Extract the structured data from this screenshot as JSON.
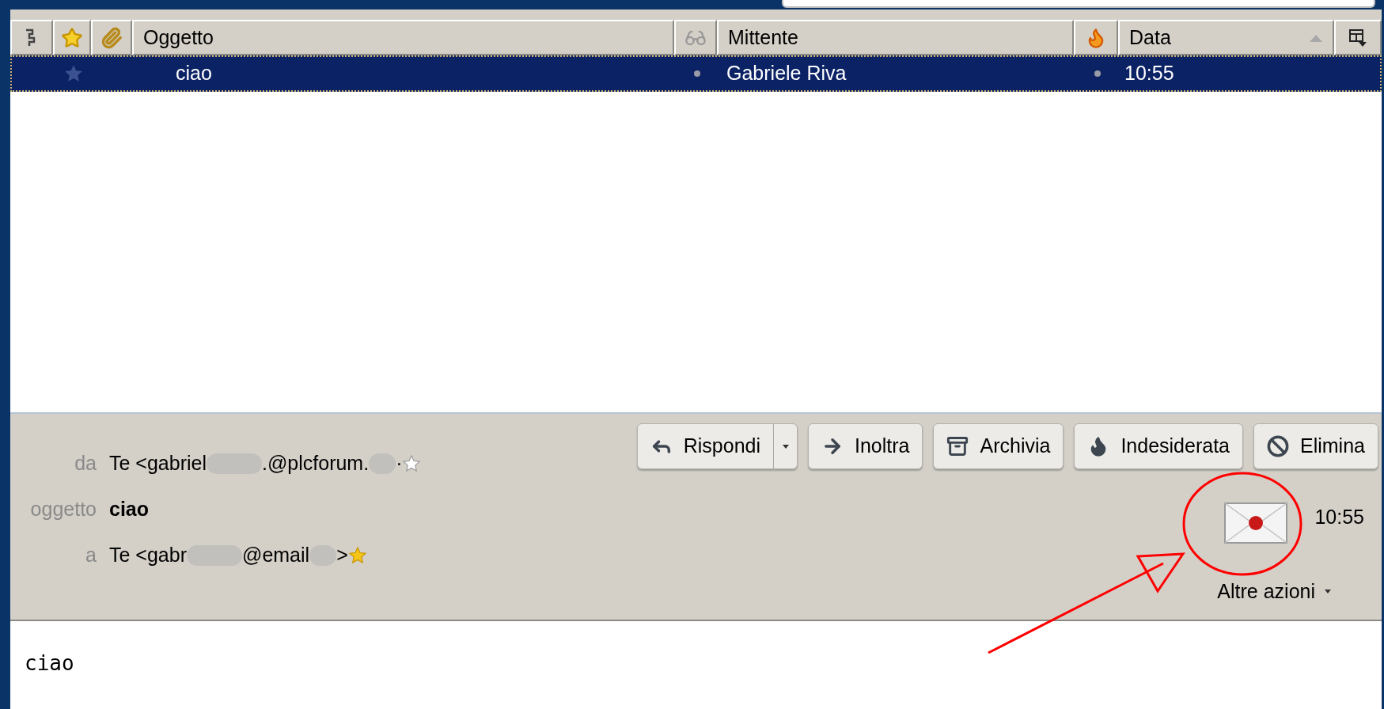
{
  "columns": [
    {
      "label": "Oggetto",
      "sorted": false
    },
    {
      "label": "Mittente",
      "sorted": false
    },
    {
      "label": "Data",
      "sorted": true
    }
  ],
  "messages": [
    {
      "subject": "ciao",
      "sender": "Gabriele Riva",
      "date": "10:55",
      "selected": true,
      "starred": false
    }
  ],
  "toolbar": [
    {
      "label": "Rispondi",
      "kind": "reply",
      "split": true
    },
    {
      "label": "Inoltra",
      "kind": "forward",
      "split": false
    },
    {
      "label": "Archivia",
      "kind": "archive",
      "split": false
    },
    {
      "label": "Indesiderata",
      "kind": "junk",
      "split": false
    },
    {
      "label": "Elimina",
      "kind": "delete",
      "split": false
    }
  ],
  "header_fields": [
    {
      "label": "da",
      "kind": "address",
      "parts": [
        "Te <gabriel",
        ".@plcforum.",
        "·"
      ],
      "starred": false
    },
    {
      "label": "oggetto",
      "kind": "subject",
      "value": "ciao"
    },
    {
      "label": "a",
      "kind": "address",
      "parts": [
        "Te <gabr",
        "@email",
        ">"
      ],
      "starred": true
    }
  ],
  "date": "10:55",
  "more_actions": "Altre azioni",
  "body": "ciao"
}
